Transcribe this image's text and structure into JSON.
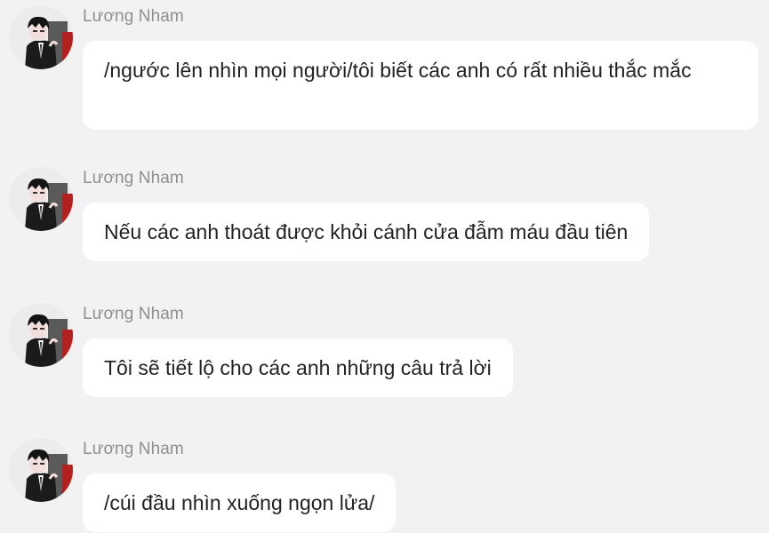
{
  "colors": {
    "background": "#f2f2f2",
    "bubble": "#ffffff",
    "sender_name": "#8f8f8f",
    "message_text": "#222222"
  },
  "messages": [
    {
      "sender": "Lương Nham",
      "avatar_icon": "avatar-character-icon",
      "text": "/ngước lên nhìn mọi người/tôi biết các anh có rất nhiều thắc mắc"
    },
    {
      "sender": "Lương Nham",
      "avatar_icon": "avatar-character-icon",
      "text": "Nếu các anh thoát được khỏi cánh cửa đẫm máu đầu tiên"
    },
    {
      "sender": "Lương Nham",
      "avatar_icon": "avatar-character-icon",
      "text": "Tôi sẽ tiết lộ cho các anh những câu trả lời"
    },
    {
      "sender": "Lương Nham",
      "avatar_icon": "avatar-character-icon",
      "text": "/cúi đầu nhìn xuống ngọn lửa/"
    }
  ]
}
